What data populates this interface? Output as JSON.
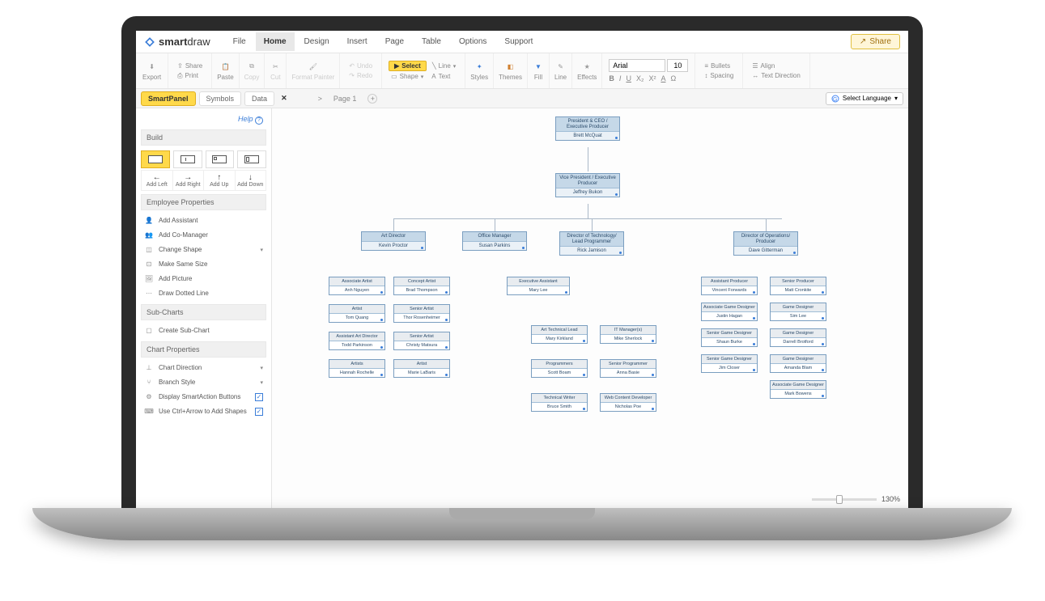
{
  "app": {
    "brand_bold": "smart",
    "brand_light": "draw"
  },
  "menu": [
    "File",
    "Home",
    "Design",
    "Insert",
    "Page",
    "Table",
    "Options",
    "Support"
  ],
  "menu_active": 1,
  "share_label": "Share",
  "ribbon": {
    "export": "Export",
    "share": "Share",
    "print": "Print",
    "paste": "Paste",
    "copy": "Copy",
    "cut": "Cut",
    "format_painter": "Format Painter",
    "undo": "Undo",
    "redo": "Redo",
    "select": "Select",
    "shape": "Shape",
    "line": "Line",
    "text": "Text",
    "styles": "Styles",
    "themes": "Themes",
    "fill": "Fill",
    "line2": "Line",
    "effects": "Effects",
    "font": "Arial",
    "size": "10",
    "bullets": "Bullets",
    "align": "Align",
    "spacing": "Spacing",
    "direction": "Text Direction"
  },
  "panel_tabs": [
    "SmartPanel",
    "Symbols",
    "Data"
  ],
  "panel_active": 0,
  "page_tab": "Page 1",
  "lang_label": "Select Language",
  "help_label": "Help",
  "sidebar": {
    "build": "Build",
    "add": [
      "Add Left",
      "Add Right",
      "Add Up",
      "Add Down"
    ],
    "emp_props": "Employee Properties",
    "emp_items": [
      "Add Assistant",
      "Add Co-Manager",
      "Change Shape",
      "Make Same Size",
      "Add Picture",
      "Draw Dotted Line"
    ],
    "subcharts": "Sub-Charts",
    "subchart_item": "Create Sub-Chart",
    "chart_props": "Chart Properties",
    "chart_items": [
      "Chart Direction",
      "Branch Style",
      "Display SmartAction Buttons",
      "Use Ctrl+Arrow to Add Shapes"
    ]
  },
  "zoom": "130%",
  "org": {
    "ceo": {
      "title": "President & CEO / Executive Producer",
      "name": "Brett McQuat"
    },
    "vp": {
      "title": "Vice President / Executive Producer",
      "name": "Jeffrey Bukon"
    },
    "directors": [
      {
        "title": "Art Director",
        "name": "Kevin Proctor"
      },
      {
        "title": "Office Manager",
        "name": "Susan Parkins"
      },
      {
        "title": "Director of Technology/ Lead Programmer",
        "name": "Rick Jamison"
      },
      {
        "title": "Director of Operations/ Producer",
        "name": "Dave Gitterman"
      }
    ],
    "col1a": [
      {
        "t": "Associate Artist",
        "n": "Anh Nguyen"
      },
      {
        "t": "Artist",
        "n": "Tom Quang"
      },
      {
        "t": "Assistant Art Director",
        "n": "Todd Parkinson"
      },
      {
        "t": "Artists",
        "n": "Hannah Rochelle"
      }
    ],
    "col1b": [
      {
        "t": "Concept Artist",
        "n": "Brad Thompson"
      },
      {
        "t": "Senior Artist",
        "n": "Thor Rosenheimer"
      },
      {
        "t": "Senior Artist",
        "n": "Christy Matsura"
      },
      {
        "t": "Artist",
        "n": "Marie LaBaris"
      }
    ],
    "col2": [
      {
        "t": "Executive Assistant",
        "n": "Mary Lee"
      }
    ],
    "col3a": [
      {
        "t": "Art Technical Lead",
        "n": "Mary Kirkland"
      },
      {
        "t": "Programmers",
        "n": "Scott Boam"
      },
      {
        "t": "Technical Writer",
        "n": "Bruce Smith"
      }
    ],
    "col3b": [
      {
        "t": "IT Manager(s)",
        "n": "Mike Sherlock"
      },
      {
        "t": "Senior Programmer",
        "n": "Anna Basie"
      },
      {
        "t": "Web Content Developer",
        "n": "Nicholas Poe"
      }
    ],
    "col4a": [
      {
        "t": "Assistant Producer",
        "n": "Vincent Forwards"
      },
      {
        "t": "Associate Game Designer",
        "n": "Justin Hagan"
      },
      {
        "t": "Senior Game Designer",
        "n": "Shaun Burke"
      },
      {
        "t": "Senior Game Designer",
        "n": "Jim Closer"
      }
    ],
    "col4b": [
      {
        "t": "Senior Producer",
        "n": "Matt Cronkite"
      },
      {
        "t": "Game Designer",
        "n": "Sim Lee"
      },
      {
        "t": "Game Designer",
        "n": "Darrell Brotford"
      },
      {
        "t": "Game Designer",
        "n": "Amanda Blam"
      },
      {
        "t": "Associate Game Designer",
        "n": "Mark Bowens"
      }
    ]
  }
}
